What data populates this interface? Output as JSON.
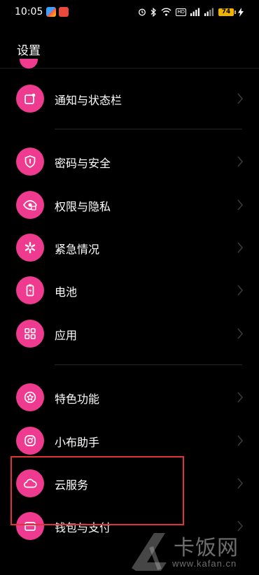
{
  "status_bar": {
    "time": "10:05",
    "battery": "74",
    "hd_badge": "HD",
    "signal_label": "5G"
  },
  "header": {
    "title": "设置"
  },
  "settings_items": [
    {
      "label": "通知与状态栏",
      "icon": "notification-icon"
    },
    {
      "label": "密码与安全",
      "icon": "shield-lock-icon"
    },
    {
      "label": "权限与隐私",
      "icon": "privacy-eye-icon"
    },
    {
      "label": "紧急情况",
      "icon": "emergency-icon"
    },
    {
      "label": "电池",
      "icon": "battery-icon"
    },
    {
      "label": "应用",
      "icon": "apps-grid-icon"
    },
    {
      "label": "特色功能",
      "icon": "star-badge-icon"
    },
    {
      "label": "小布助手",
      "icon": "assistant-icon"
    },
    {
      "label": "云服务",
      "icon": "cloud-icon"
    },
    {
      "label": "钱包与支付",
      "icon": "wallet-icon"
    }
  ],
  "watermark": {
    "brand": "卡饭网",
    "url": "www.kafan.cn"
  },
  "colors": {
    "accent": "#ee3a8f",
    "background": "#000000",
    "highlight": "#e03333"
  }
}
